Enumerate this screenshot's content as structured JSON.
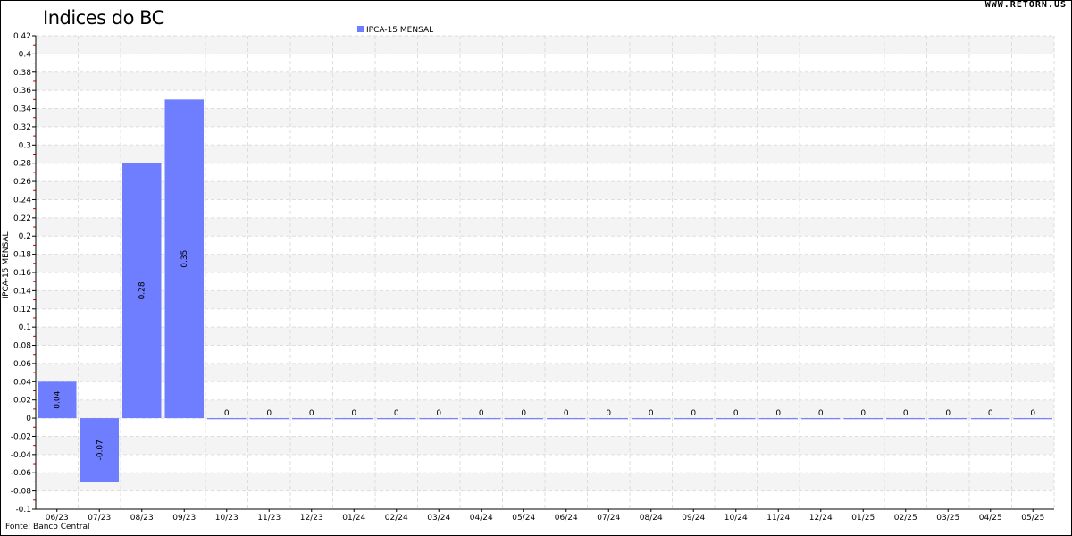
{
  "title": "Indices do BC",
  "watermark": "WWW.RETORN.US",
  "source": "Fonte: Banco Central",
  "colors": {
    "bar": "#6f7dff",
    "grid": "#dddddd",
    "band": "#f4f4f4",
    "tick_red": "#cc0000"
  },
  "chart_data": {
    "type": "bar",
    "categories": [
      "06/23",
      "07/23",
      "08/23",
      "09/23",
      "10/23",
      "11/23",
      "12/23",
      "01/24",
      "02/24",
      "03/24",
      "04/24",
      "05/24",
      "06/24",
      "07/24",
      "08/24",
      "09/24",
      "10/24",
      "11/24",
      "12/24",
      "01/25",
      "02/25",
      "03/25",
      "04/25",
      "05/25"
    ],
    "series": [
      {
        "name": "IPCA-15 MENSAL",
        "values": [
          0.04,
          -0.07,
          0.28,
          0.35,
          0,
          0,
          0,
          0,
          0,
          0,
          0,
          0,
          0,
          0,
          0,
          0,
          0,
          0,
          0,
          0,
          0,
          0,
          0,
          0
        ]
      }
    ],
    "ylabel": "IPCA-15 MENSAL",
    "ylim": [
      -0.1,
      0.42
    ],
    "yticks": [
      "-0.1",
      "-0.08",
      "-0.06",
      "-0.04",
      "-0.02",
      "0",
      "0.02",
      "0.04",
      "0.06",
      "0.08",
      "0.1",
      "0.12",
      "0.14",
      "0.16",
      "0.18",
      "0.2",
      "0.22",
      "0.24",
      "0.26",
      "0.28",
      "0.3",
      "0.32",
      "0.34",
      "0.36",
      "0.38",
      "0.4",
      "0.42"
    ],
    "data_labels": [
      "0.04",
      "-0.07",
      "0.28",
      "0.35",
      "0",
      "0",
      "0",
      "0",
      "0",
      "0",
      "0",
      "0",
      "0",
      "0",
      "0",
      "0",
      "0",
      "0",
      "0",
      "0",
      "0",
      "0",
      "0",
      "0"
    ],
    "legend": "top-center",
    "grid": true
  }
}
